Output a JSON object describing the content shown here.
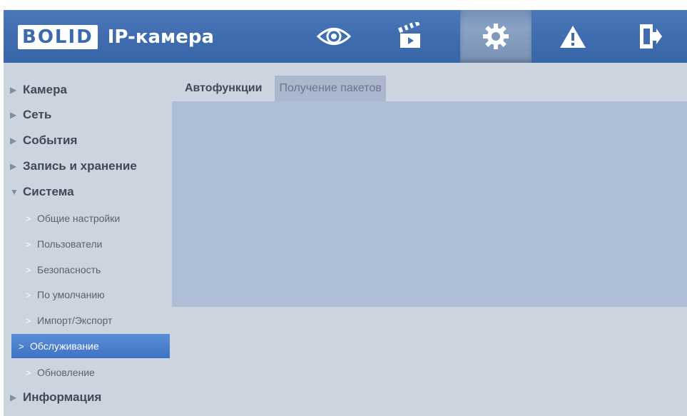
{
  "header": {
    "logo_text": "BOLID",
    "app_title": "IP-камера",
    "nav": [
      {
        "icon": "eye-icon",
        "label": "Просмотр"
      },
      {
        "icon": "clapperboard-icon",
        "label": "Воспроизведение"
      },
      {
        "icon": "gear-icon",
        "label": "Настройка",
        "active": true
      },
      {
        "icon": "warning-icon",
        "label": "Тревога"
      },
      {
        "icon": "logout-icon",
        "label": "Выход"
      }
    ]
  },
  "sidebar": {
    "items": [
      {
        "label": "Камера"
      },
      {
        "label": "Сеть"
      },
      {
        "label": "События"
      },
      {
        "label": "Запись и хранение"
      },
      {
        "label": "Система",
        "expanded": true
      },
      {
        "label": "Информация"
      }
    ],
    "system_subitems": [
      {
        "label": "Общие настройки"
      },
      {
        "label": "Пользователи"
      },
      {
        "label": "Безопасность"
      },
      {
        "label": "По умолчанию"
      },
      {
        "label": "Импорт/Экспорт"
      },
      {
        "label": "Обслуживание",
        "selected": true
      },
      {
        "label": "Обновление"
      }
    ]
  },
  "tabs": [
    {
      "label": "Автофункции",
      "active": true
    },
    {
      "label": "Получение пакетов",
      "active": false
    }
  ],
  "colors": {
    "header_blue": "#3f6db0",
    "content_bg": "#ccd4e0",
    "panel_bg": "#aebdd6",
    "selected_item": "#4a80cc"
  }
}
